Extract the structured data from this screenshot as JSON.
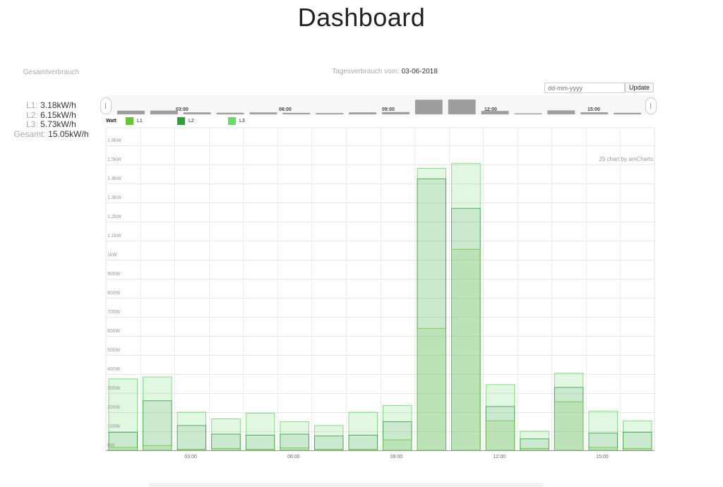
{
  "header": {
    "title": "Dashboard"
  },
  "summary": {
    "heading": "Gesamtverbrauch",
    "rows": [
      {
        "label": "L1:",
        "value": "3.18kW/h"
      },
      {
        "label": "L2:",
        "value": "6.15kW/h"
      },
      {
        "label": "L3:",
        "value": "5.73kW/h"
      },
      {
        "label": "Gesamt:",
        "value": "15.05kW/h"
      }
    ]
  },
  "day": {
    "label": "Tagesverbrauch vom:",
    "date": "03-06-2018"
  },
  "controls": {
    "date_placeholder": "dd-mm-yyyy",
    "update_label": "Update"
  },
  "navigator": {
    "labels": [
      "03:00",
      "06:00",
      "09:00",
      "12:00",
      "15:00"
    ]
  },
  "legend": {
    "unit": "Watt"
  },
  "credit": "JS chart by amCharts",
  "chart_data": {
    "type": "bar",
    "stacked": false,
    "ylabel": "Watt",
    "ylim": [
      0,
      1700
    ],
    "y_ticks": [
      "0W",
      "100W",
      "200W",
      "300W",
      "400W",
      "500W",
      "600W",
      "700W",
      "800W",
      "900W",
      "1kW",
      "1.1kW",
      "1.2kW",
      "1.3kW",
      "1.4kW",
      "1.5kW",
      "1.6kW"
    ],
    "y_tick_values": [
      0,
      100,
      200,
      300,
      400,
      500,
      600,
      700,
      800,
      900,
      1000,
      1100,
      1200,
      1300,
      1400,
      1500,
      1600
    ],
    "x_tick_labels": [
      "03:00",
      "06:00",
      "09:00",
      "12:00",
      "15:00"
    ],
    "x_tick_index": [
      2,
      5,
      8,
      11,
      14
    ],
    "bar_count": 16,
    "grid": true,
    "series": [
      {
        "name": "L1",
        "color": "#66c33a",
        "values": [
          15,
          25,
          5,
          10,
          5,
          12,
          5,
          5,
          55,
          640,
          1055,
          155,
          10,
          255,
          15,
          10
        ]
      },
      {
        "name": "L2",
        "color": "#2e9f3c",
        "values": [
          95,
          260,
          130,
          85,
          80,
          85,
          75,
          80,
          150,
          1425,
          1270,
          230,
          60,
          330,
          90,
          95
        ]
      },
      {
        "name": "L3",
        "color": "#66dd66",
        "values": [
          375,
          385,
          200,
          165,
          195,
          150,
          130,
          200,
          235,
          1480,
          1505,
          345,
          100,
          405,
          205,
          155
        ]
      }
    ]
  }
}
